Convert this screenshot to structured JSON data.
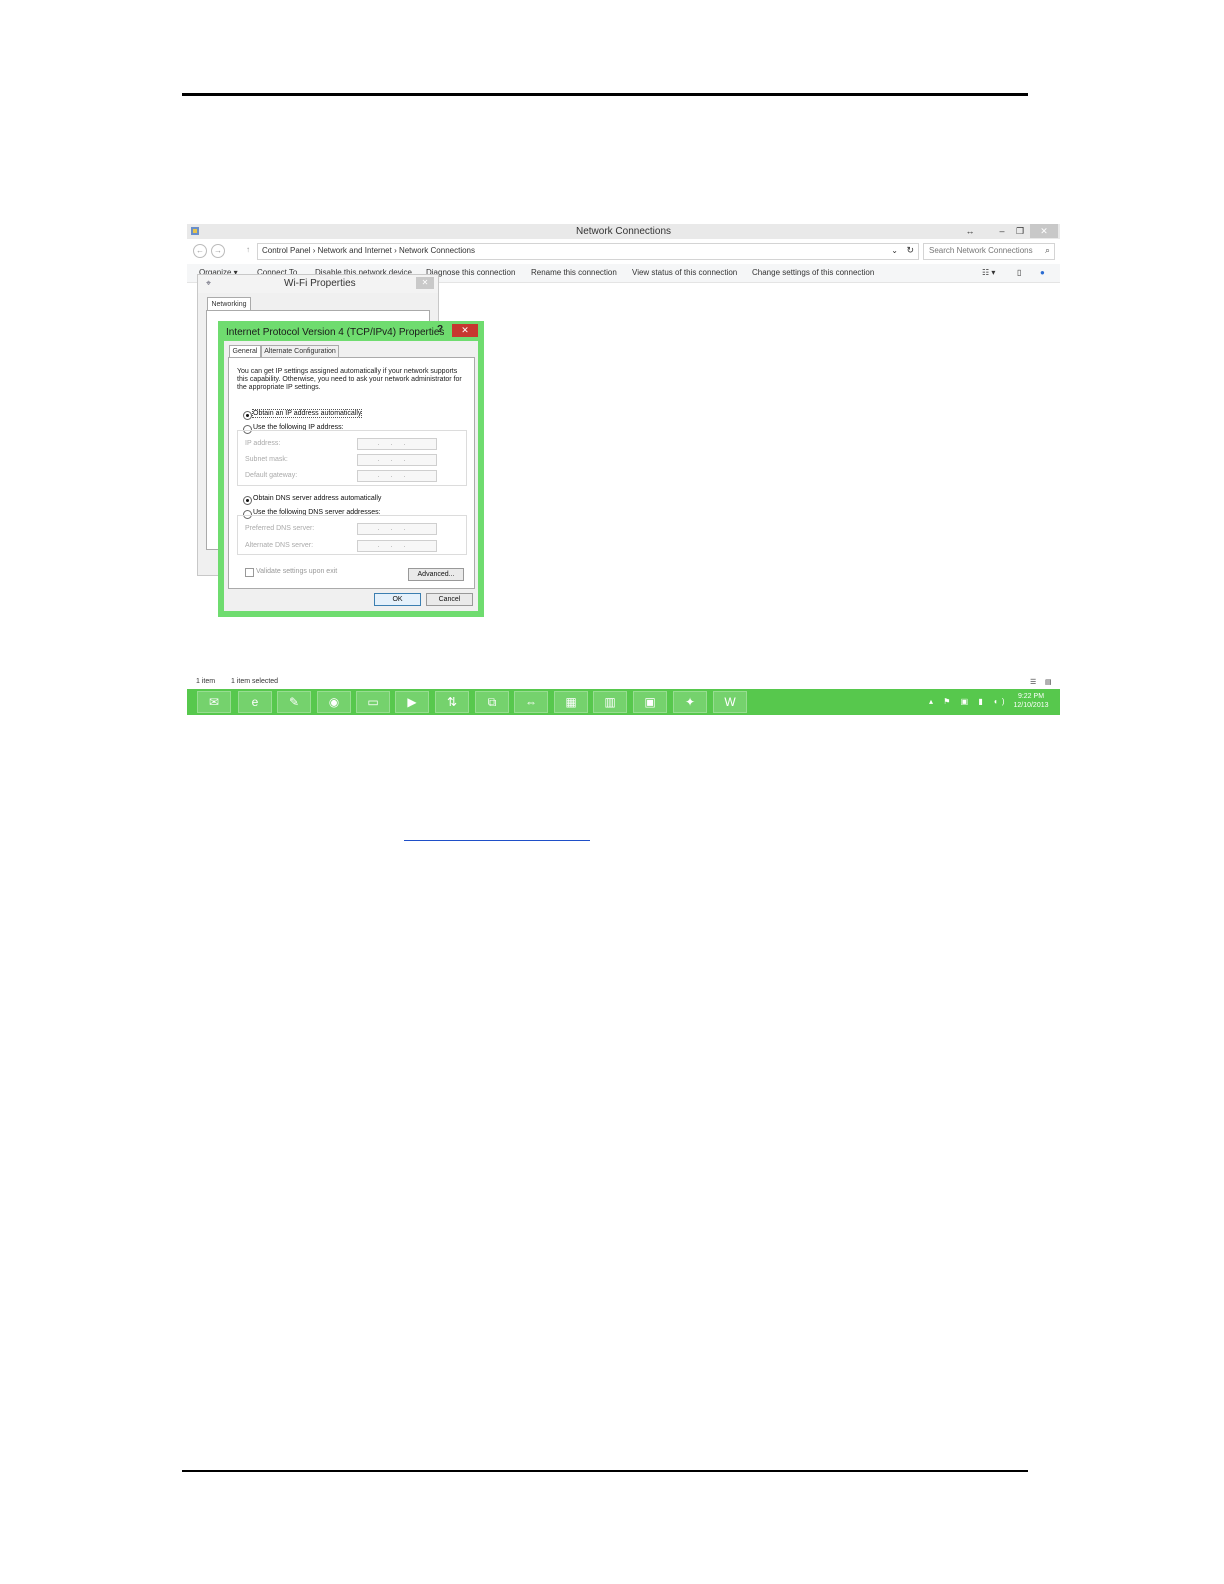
{
  "window": {
    "title": "Network Connections",
    "buttons": {
      "minimize": "–",
      "restore": "❐",
      "close": "✕"
    },
    "extra": "↔"
  },
  "address": {
    "breadcrumbs": "Control Panel  ›  Network and Internet  ›  Network Connections",
    "search_placeholder": "Search Network Connections"
  },
  "commands": [
    "Organize ▾",
    "Connect To",
    "Disable this network device",
    "Diagnose this connection",
    "Rename this connection",
    "View status of this connection",
    "Change settings of this connection"
  ],
  "wifi_dialog": {
    "title": "Wi-Fi Properties",
    "tab": "Networking",
    "close": "✕"
  },
  "ipv4_dialog": {
    "title": "Internet Protocol Version 4 (TCP/IPv4) Properties",
    "help": "?",
    "close": "✕",
    "tabs": [
      "General",
      "Alternate Configuration"
    ],
    "intro": "You can get IP settings assigned automatically if your network supports this capability. Otherwise, you need to ask your network administrator for the appropriate IP settings.",
    "ip_auto": "Obtain an IP address automatically",
    "ip_manual": "Use the following IP address:",
    "ip_address": "IP address:",
    "subnet_mask": "Subnet mask:",
    "default_gateway": "Default gateway:",
    "dns_auto": "Obtain DNS server address automatically",
    "dns_manual": "Use the following DNS server addresses:",
    "preferred_dns": "Preferred DNS server:",
    "alternate_dns": "Alternate DNS server:",
    "ip_placeholder": "...",
    "validate": "Validate settings upon exit",
    "advanced": "Advanced...",
    "ok": "OK",
    "cancel": "Cancel"
  },
  "status": {
    "items": "1 item",
    "selected": "1 item selected"
  },
  "taskbar": {
    "apps": [
      "outlook-icon",
      "ie-icon",
      "notepad-icon",
      "firefox-icon",
      "explorer-icon",
      "media-icon",
      "transfer-icon",
      "network-icon",
      "teamviewer-icon",
      "spreadsheet-icon",
      "calculator-icon",
      "remote-desktop-icon",
      "acrobat-icon",
      "word-icon"
    ],
    "tray": "▴ ⚑ ▣ ▮ ◖)",
    "time": "9:22 PM",
    "date": "12/10/2013"
  }
}
